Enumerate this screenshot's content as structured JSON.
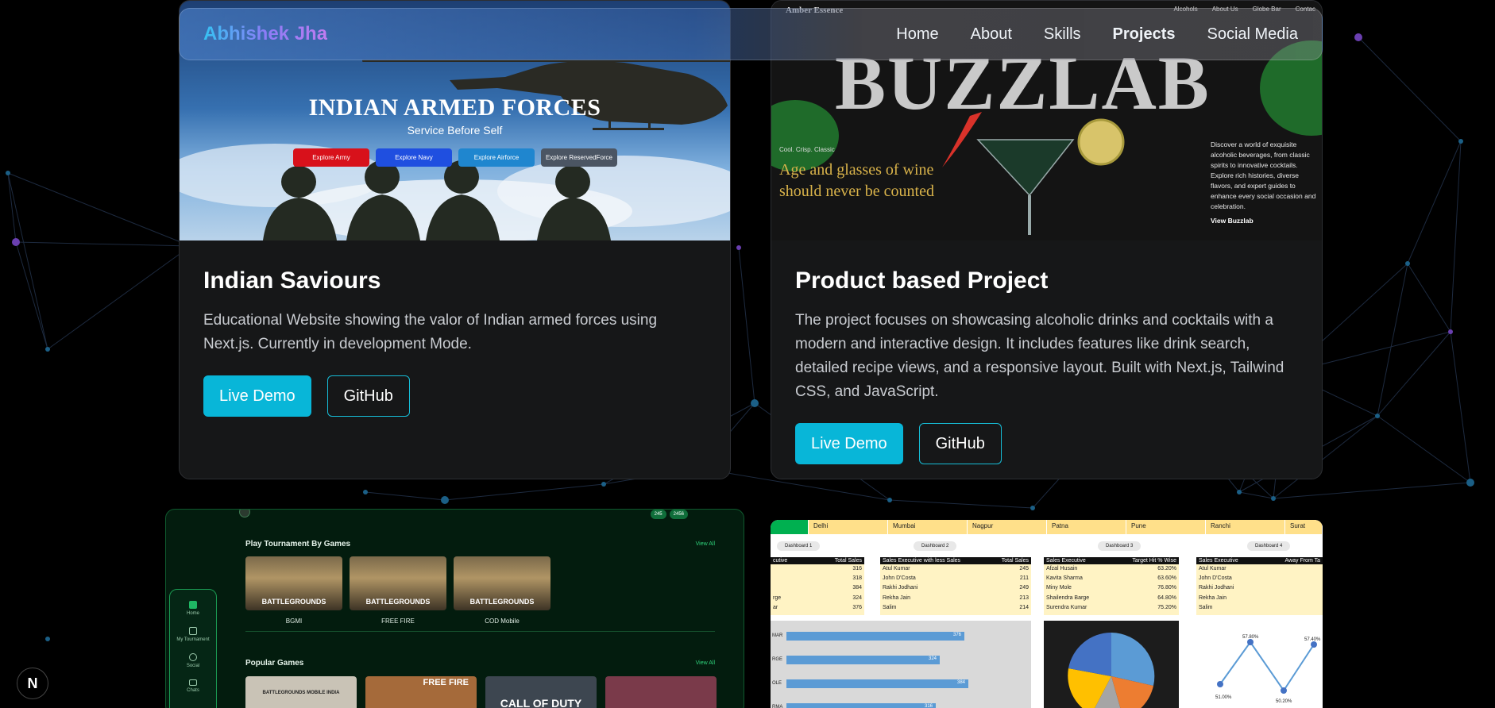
{
  "brand": {
    "name": "Abhishek Jha"
  },
  "nav": {
    "items": [
      {
        "label": "Home"
      },
      {
        "label": "About"
      },
      {
        "label": "Skills"
      },
      {
        "label": "Projects",
        "active": true
      },
      {
        "label": "Social Media"
      }
    ]
  },
  "projects": [
    {
      "title": "Indian Saviours",
      "description": "Educational Website showing the valor of Indian armed forces using Next.js. Currently in development Mode.",
      "live_label": "Live Demo",
      "github_label": "GitHub",
      "thumbnail": {
        "heading": "INDIAN ARMED FORCES",
        "subheading": "Service Before Self",
        "buttons": [
          {
            "label": "Explore Army",
            "color": "#d8111b"
          },
          {
            "label": "Explore Navy",
            "color": "#1f4fe0"
          },
          {
            "label": "Explore Airforce",
            "color": "#1f86cf"
          },
          {
            "label": "Explore ReservedForce",
            "color": "#4b5563"
          }
        ]
      }
    },
    {
      "title": "Product based Project",
      "description": "The project focuses on showcasing alcoholic drinks and cocktails with a modern and interactive design. It includes features like drink search, detailed recipe views, and a responsive layout. Built with Next.js, Tailwind CSS, and JavaScript.",
      "live_label": "Live Demo",
      "github_label": "GitHub",
      "thumbnail": {
        "site_name": "Amber Essence",
        "menu": [
          "Alcohols",
          "About Us",
          "Globe Bar",
          "Contac"
        ],
        "heading": "BUZZLAB",
        "tagline": "Cool. Crisp. Classic",
        "quote": "Age and glasses of wine should never be counted",
        "description": "Discover a world of exquisite alcoholic beverages, from classic spirits to innovative cocktails. Explore rich histories, diverse flavors, and expert guides to enhance every social occasion and celebration.",
        "link": "View Buzzlab"
      }
    }
  ],
  "game_preview": {
    "section1": "Play Tournament By Games",
    "section2": "Popular Games",
    "view_all": "View All",
    "badges": [
      "245",
      "2456"
    ],
    "games": [
      "BGMI",
      "FREE FIRE",
      "COD Mobile"
    ],
    "sidebar": [
      "Home",
      "My Tournament",
      "Social",
      "Chats"
    ],
    "tile_text": "BATTLEGROUNDS",
    "popular": [
      "BATTLEGROUNDS MOBILE INDIA",
      "FREE FIRE",
      "CALL OF DUTY",
      ""
    ]
  },
  "dashboard_preview": {
    "cities": [
      "",
      "Delhi",
      "Mumbai",
      "Nagpur",
      "Patna",
      "Pune",
      "Ranchi",
      "Surat"
    ],
    "tabs": [
      "Dashboard 1",
      "Dashboard 2",
      "Dashboard 3",
      "Dashboard 4"
    ],
    "tables": [
      {
        "headers": [
          "cutive",
          "Total Sales"
        ],
        "rows": [
          [
            "",
            "316"
          ],
          [
            "",
            "318"
          ],
          [
            "",
            "384"
          ],
          [
            "rge",
            "324"
          ],
          [
            "ar",
            "376"
          ]
        ]
      },
      {
        "headers": [
          "Sales Executive with less Sales",
          "Total Sales"
        ],
        "rows": [
          [
            "Atul Kumar",
            "245"
          ],
          [
            "John D'Costa",
            "211"
          ],
          [
            "Rakhi Jodhani",
            "249"
          ],
          [
            "Rekha Jain",
            "213"
          ],
          [
            "Salim",
            "214"
          ]
        ]
      },
      {
        "headers": [
          "Sales Executive",
          "Target Hit % Wise"
        ],
        "rows": [
          [
            "Afzal Husain",
            "63.20%"
          ],
          [
            "Kavita Sharma",
            "63.60%"
          ],
          [
            "Miny Mole",
            "76.80%"
          ],
          [
            "Shailendra Barge",
            "64.80%"
          ],
          [
            "Surendra Kumar",
            "75.20%"
          ]
        ]
      },
      {
        "headers": [
          "Sales Executive",
          "Away From Ta"
        ],
        "rows": [
          [
            "Atul Kumar",
            ""
          ],
          [
            "John D'Costa",
            ""
          ],
          [
            "Rakhi Jodhani",
            ""
          ],
          [
            "Rekha Jain",
            ""
          ],
          [
            "Salim",
            ""
          ]
        ]
      }
    ],
    "bar_chart": {
      "categories": [
        "MAR",
        "RGE",
        "OLE",
        "RMA"
      ],
      "values": [
        376,
        324,
        384,
        316
      ]
    },
    "line_chart": {
      "labels": [
        "51.00%",
        "57.80%",
        "50.20%",
        "57.40%"
      ]
    },
    "pie_colors": [
      "#5b9bd5",
      "#ed7d31",
      "#a5a5a5",
      "#ffc000",
      "#4472c4"
    ]
  },
  "next_badge": "N"
}
